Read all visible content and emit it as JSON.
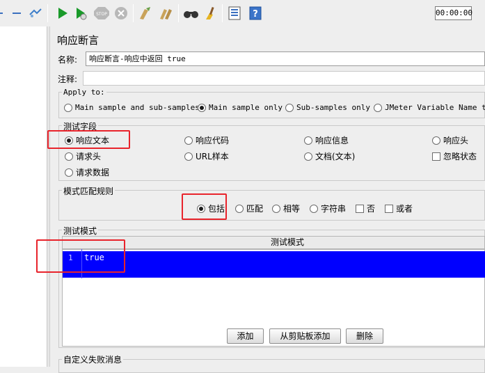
{
  "toolbar": {
    "timer": "00:00:00",
    "icons": [
      "collapse-icon",
      "toggle-icon",
      "start-icon",
      "start-no-pause-icon",
      "stop-icon",
      "shutdown-icon",
      "clear-icon",
      "clear-all-icon",
      "search-icon",
      "reset-search-icon",
      "function-helper-icon",
      "help-icon"
    ]
  },
  "panel": {
    "title": "响应断言",
    "name_label": "名称:",
    "name_value": "响应断言-响应中返回 true",
    "comment_label": "注释:"
  },
  "apply_to": {
    "title": "Apply to:",
    "options": [
      "Main sample and sub-samples",
      "Main sample only",
      "Sub-samples only",
      "JMeter Variable Name to"
    ],
    "selected": "Main sample only"
  },
  "test_field": {
    "title": "测试字段",
    "options": [
      "响应文本",
      "响应代码",
      "响应信息",
      "响应头",
      "请求头",
      "URL样本",
      "文档(文本)",
      "请求数据"
    ],
    "checkbox": "忽略状态",
    "selected": "响应文本"
  },
  "pattern_rules": {
    "title": "模式匹配规则",
    "radios": [
      "包括",
      "匹配",
      "相等",
      "字符串"
    ],
    "checks": [
      "否",
      "或者"
    ],
    "selected": "包括"
  },
  "patterns": {
    "title": "测试模式",
    "column_header": "测试模式",
    "rows": [
      {
        "line": "1",
        "value": "true"
      }
    ]
  },
  "buttons": {
    "add": "添加",
    "add_clipboard": "从剪贴板添加",
    "delete": "删除"
  },
  "custom_failure": {
    "title": "自定义失败消息"
  },
  "colors": {
    "selection": "#0000ff",
    "highlight": "#e8232b"
  }
}
